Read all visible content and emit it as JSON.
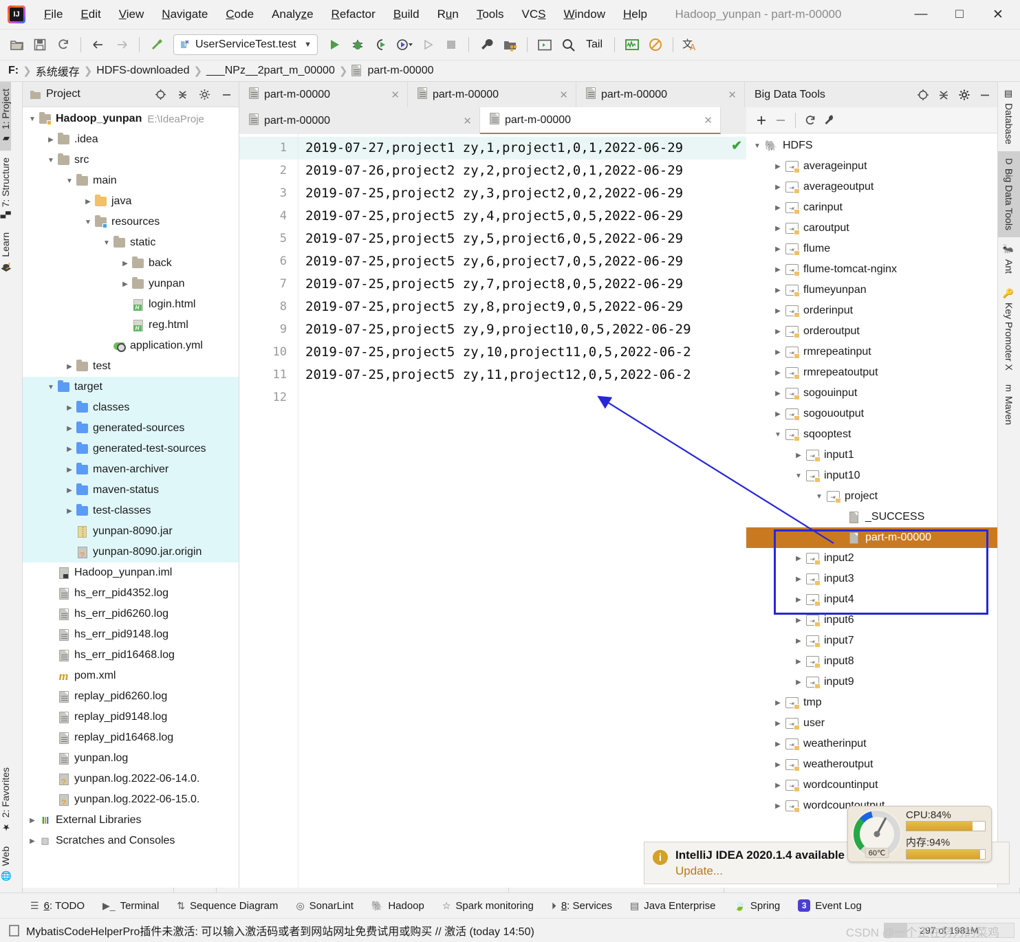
{
  "window": {
    "title": "Hadoop_yunpan - part-m-00000",
    "minimize": "—",
    "maximize": "□",
    "close": "✕"
  },
  "menubar": [
    {
      "label": "File",
      "mnemonic": "F"
    },
    {
      "label": "Edit",
      "mnemonic": "E"
    },
    {
      "label": "View",
      "mnemonic": "V"
    },
    {
      "label": "Navigate",
      "mnemonic": "N"
    },
    {
      "label": "Code",
      "mnemonic": "C"
    },
    {
      "label": "Analyze",
      "mnemonic": "z"
    },
    {
      "label": "Refactor",
      "mnemonic": "R"
    },
    {
      "label": "Build",
      "mnemonic": "B"
    },
    {
      "label": "Run",
      "mnemonic": "u"
    },
    {
      "label": "Tools",
      "mnemonic": "T"
    },
    {
      "label": "VCS",
      "mnemonic": "S"
    },
    {
      "label": "Window",
      "mnemonic": "W"
    },
    {
      "label": "Help",
      "mnemonic": "H"
    }
  ],
  "toolbar": {
    "run_config": "UserServiceTest.test",
    "tail_label": "Tail",
    "icons": [
      "open-folder-icon",
      "save-icon",
      "sync-icon",
      "back-arrow-icon",
      "forward-arrow-icon",
      "build-icon",
      "run-icon",
      "debug-icon",
      "run-coverage-icon",
      "profile-icon",
      "run-step-icon",
      "stop-icon",
      "settings-wrench-icon",
      "project-structure-icon",
      "terminal-window-icon",
      "search-icon",
      "monitor-icon",
      "block-icon",
      "translate-icon"
    ]
  },
  "breadcrumb": {
    "items": [
      "F:",
      "系统缓存",
      "HDFS-downloaded",
      "___NPz__2part_m_00000",
      "part-m-00000"
    ]
  },
  "left_strip": {
    "top": [
      {
        "label": "1: Project",
        "icon": "project-folder-icon",
        "selected": true
      },
      {
        "label": "7: Structure",
        "icon": "structure-icon",
        "selected": false
      },
      {
        "label": "Learn",
        "icon": "graduation-cap-icon",
        "selected": false
      }
    ],
    "bottom": [
      {
        "label": "2: Favorites",
        "icon": "star-icon",
        "selected": false
      },
      {
        "label": "Web",
        "icon": "globe-icon",
        "selected": false
      }
    ]
  },
  "right_strip": {
    "items": [
      {
        "label": "Database",
        "icon": "database-icon",
        "selected": false
      },
      {
        "label": "Big Data Tools",
        "icon": "bigdata-icon",
        "selected": true
      },
      {
        "label": "Ant",
        "icon": "ant-icon",
        "selected": false
      },
      {
        "label": "Key Promoter X",
        "icon": "key-promoter-icon",
        "selected": false
      },
      {
        "label": "Maven",
        "icon": "maven-icon",
        "selected": false
      }
    ]
  },
  "project_panel": {
    "title": "Project",
    "header_icons": [
      "locate-icon",
      "collapse-all-icon",
      "settings-gear-icon",
      "minimize-icon"
    ],
    "tree": [
      {
        "label": "Hadoop_yunpan",
        "suffix": "E:\\IdeaProje",
        "indent": 0,
        "arrow": "down",
        "icon": "module-folder-icon",
        "bold": true,
        "highlight": false
      },
      {
        "label": ".idea",
        "indent": 1,
        "arrow": "right",
        "icon": "folder-icon",
        "highlight": false
      },
      {
        "label": "src",
        "indent": 1,
        "arrow": "down",
        "icon": "folder-icon",
        "highlight": false
      },
      {
        "label": "main",
        "indent": 2,
        "arrow": "down",
        "icon": "folder-icon",
        "highlight": false
      },
      {
        "label": "java",
        "indent": 3,
        "arrow": "right",
        "icon": "source-folder-icon",
        "highlight": false
      },
      {
        "label": "resources",
        "indent": 3,
        "arrow": "down",
        "icon": "resource-folder-icon",
        "highlight": false
      },
      {
        "label": "static",
        "indent": 4,
        "arrow": "down",
        "icon": "folder-icon",
        "highlight": false
      },
      {
        "label": "back",
        "indent": 5,
        "arrow": "right",
        "icon": "folder-icon",
        "highlight": false
      },
      {
        "label": "yunpan",
        "indent": 5,
        "arrow": "right",
        "icon": "folder-icon",
        "highlight": false
      },
      {
        "label": "login.html",
        "indent": 5,
        "arrow": "none",
        "icon": "html-file-icon",
        "highlight": false
      },
      {
        "label": "reg.html",
        "indent": 5,
        "arrow": "none",
        "icon": "html-file-icon",
        "highlight": false
      },
      {
        "label": "application.yml",
        "indent": 4,
        "arrow": "none",
        "icon": "spring-yml-icon",
        "highlight": false
      },
      {
        "label": "test",
        "indent": 2,
        "arrow": "right",
        "icon": "folder-icon",
        "highlight": false
      },
      {
        "label": "target",
        "indent": 1,
        "arrow": "down",
        "icon": "blue-folder-icon",
        "highlight": true
      },
      {
        "label": "classes",
        "indent": 2,
        "arrow": "right",
        "icon": "blue-folder-icon",
        "highlight": true
      },
      {
        "label": "generated-sources",
        "indent": 2,
        "arrow": "right",
        "icon": "blue-folder-icon",
        "highlight": true
      },
      {
        "label": "generated-test-sources",
        "indent": 2,
        "arrow": "right",
        "icon": "blue-folder-icon",
        "highlight": true
      },
      {
        "label": "maven-archiver",
        "indent": 2,
        "arrow": "right",
        "icon": "blue-folder-icon",
        "highlight": true
      },
      {
        "label": "maven-status",
        "indent": 2,
        "arrow": "right",
        "icon": "blue-folder-icon",
        "highlight": true
      },
      {
        "label": "test-classes",
        "indent": 2,
        "arrow": "right",
        "icon": "blue-folder-icon",
        "highlight": true
      },
      {
        "label": "yunpan-8090.jar",
        "indent": 2,
        "arrow": "none",
        "icon": "jar-file-icon",
        "highlight": true
      },
      {
        "label": "yunpan-8090.jar.origin",
        "indent": 2,
        "arrow": "none",
        "icon": "unknown-file-icon",
        "highlight": true
      },
      {
        "label": "Hadoop_yunpan.iml",
        "indent": 1,
        "arrow": "none",
        "icon": "iml-file-icon",
        "highlight": false
      },
      {
        "label": "hs_err_pid4352.log",
        "indent": 1,
        "arrow": "none",
        "icon": "text-file-icon",
        "highlight": false
      },
      {
        "label": "hs_err_pid6260.log",
        "indent": 1,
        "arrow": "none",
        "icon": "text-file-icon",
        "highlight": false
      },
      {
        "label": "hs_err_pid9148.log",
        "indent": 1,
        "arrow": "none",
        "icon": "text-file-icon",
        "highlight": false
      },
      {
        "label": "hs_err_pid16468.log",
        "indent": 1,
        "arrow": "none",
        "icon": "text-file-icon",
        "highlight": false
      },
      {
        "label": "pom.xml",
        "indent": 1,
        "arrow": "none",
        "icon": "maven-pom-icon",
        "highlight": false
      },
      {
        "label": "replay_pid6260.log",
        "indent": 1,
        "arrow": "none",
        "icon": "text-file-icon",
        "highlight": false
      },
      {
        "label": "replay_pid9148.log",
        "indent": 1,
        "arrow": "none",
        "icon": "text-file-icon",
        "highlight": false
      },
      {
        "label": "replay_pid16468.log",
        "indent": 1,
        "arrow": "none",
        "icon": "text-file-icon",
        "highlight": false
      },
      {
        "label": "yunpan.log",
        "indent": 1,
        "arrow": "none",
        "icon": "text-file-icon",
        "highlight": false
      },
      {
        "label": "yunpan.log.2022-06-14.0.",
        "indent": 1,
        "arrow": "none",
        "icon": "unknown-file-icon",
        "highlight": false
      },
      {
        "label": "yunpan.log.2022-06-15.0.",
        "indent": 1,
        "arrow": "none",
        "icon": "unknown-file-icon",
        "highlight": false
      },
      {
        "label": "External Libraries",
        "indent": 0,
        "arrow": "right",
        "icon": "libraries-icon",
        "highlight": false
      },
      {
        "label": "Scratches and Consoles",
        "indent": 0,
        "arrow": "right",
        "icon": "scratches-icon",
        "highlight": false
      }
    ]
  },
  "editor": {
    "tabs_row1": [
      {
        "label": "part-m-00000",
        "active": false
      },
      {
        "label": "part-m-00000",
        "active": false
      },
      {
        "label": "part-m-00000",
        "active": false
      }
    ],
    "tabs_row2": [
      {
        "label": "part-m-00000",
        "active": false
      },
      {
        "label": "part-m-00000",
        "active": true
      }
    ],
    "line_numbers": [
      "1",
      "2",
      "3",
      "4",
      "5",
      "6",
      "7",
      "8",
      "9",
      "10",
      "11",
      "12"
    ],
    "lines": [
      "2019-07-27,project1 zy,1,project1,0,1,2022-06-29",
      "2019-07-26,project2 zy,2,project2,0,1,2022-06-29",
      "2019-07-25,project2 zy,3,project2,0,2,2022-06-29",
      "2019-07-25,project5 zy,4,project5,0,5,2022-06-29",
      "2019-07-25,project5 zy,5,project6,0,5,2022-06-29",
      "2019-07-25,project5 zy,6,project7,0,5,2022-06-29",
      "2019-07-25,project5 zy,7,project8,0,5,2022-06-29",
      "2019-07-25,project5 zy,8,project9,0,5,2022-06-29",
      "2019-07-25,project5 zy,9,project10,0,5,2022-06-29",
      "2019-07-25,project5 zy,10,project11,0,5,2022-06-2",
      "2019-07-25,project5 zy,11,project12,0,5,2022-06-2",
      ""
    ],
    "inspection_ok": "✔"
  },
  "bigdata": {
    "title": "Big Data Tools",
    "header_icons": [
      "locate-icon",
      "collapse-all-icon",
      "settings-gear-icon",
      "minimize-icon"
    ],
    "toolbar_icons": [
      "add-icon",
      "remove-icon",
      "refresh-icon",
      "wrench-icon"
    ],
    "tree": [
      {
        "label": "HDFS",
        "indent": 0,
        "arrow": "down",
        "icon": "hadoop-elephant-icon",
        "state": "normal"
      },
      {
        "label": "averageinput",
        "indent": 1,
        "arrow": "right",
        "icon": "hdfs-folder-icon",
        "state": "normal"
      },
      {
        "label": "averageoutput",
        "indent": 1,
        "arrow": "right",
        "icon": "hdfs-folder-icon",
        "state": "normal"
      },
      {
        "label": "carinput",
        "indent": 1,
        "arrow": "right",
        "icon": "hdfs-folder-icon",
        "state": "normal"
      },
      {
        "label": "caroutput",
        "indent": 1,
        "arrow": "right",
        "icon": "hdfs-folder-icon",
        "state": "normal"
      },
      {
        "label": "flume",
        "indent": 1,
        "arrow": "right",
        "icon": "hdfs-folder-icon",
        "state": "normal"
      },
      {
        "label": "flume-tomcat-nginx",
        "indent": 1,
        "arrow": "right",
        "icon": "hdfs-folder-icon",
        "state": "normal"
      },
      {
        "label": "flumeyunpan",
        "indent": 1,
        "arrow": "right",
        "icon": "hdfs-folder-icon",
        "state": "normal"
      },
      {
        "label": "orderinput",
        "indent": 1,
        "arrow": "right",
        "icon": "hdfs-folder-icon",
        "state": "normal"
      },
      {
        "label": "orderoutput",
        "indent": 1,
        "arrow": "right",
        "icon": "hdfs-folder-icon",
        "state": "normal"
      },
      {
        "label": "rmrepeatinput",
        "indent": 1,
        "arrow": "right",
        "icon": "hdfs-folder-icon",
        "state": "normal"
      },
      {
        "label": "rmrepeatoutput",
        "indent": 1,
        "arrow": "right",
        "icon": "hdfs-folder-icon",
        "state": "normal"
      },
      {
        "label": "sogouinput",
        "indent": 1,
        "arrow": "right",
        "icon": "hdfs-folder-icon",
        "state": "normal"
      },
      {
        "label": "sogououtput",
        "indent": 1,
        "arrow": "right",
        "icon": "hdfs-folder-icon",
        "state": "normal"
      },
      {
        "label": "sqooptest",
        "indent": 1,
        "arrow": "down",
        "icon": "hdfs-folder-icon",
        "state": "normal"
      },
      {
        "label": "input1",
        "indent": 2,
        "arrow": "right",
        "icon": "hdfs-folder-icon",
        "state": "normal"
      },
      {
        "label": "input10",
        "indent": 2,
        "arrow": "down",
        "icon": "hdfs-folder-icon",
        "state": "normal"
      },
      {
        "label": "project",
        "indent": 3,
        "arrow": "down",
        "icon": "hdfs-folder-icon",
        "state": "normal"
      },
      {
        "label": "_SUCCESS",
        "indent": 4,
        "arrow": "none",
        "icon": "hdfs-file-icon",
        "state": "normal"
      },
      {
        "label": "part-m-00000",
        "indent": 4,
        "arrow": "none",
        "icon": "hdfs-file-icon",
        "state": "selected"
      },
      {
        "label": "input2",
        "indent": 2,
        "arrow": "right",
        "icon": "hdfs-folder-icon",
        "state": "normal"
      },
      {
        "label": "input3",
        "indent": 2,
        "arrow": "right",
        "icon": "hdfs-folder-icon",
        "state": "normal"
      },
      {
        "label": "input4",
        "indent": 2,
        "arrow": "right",
        "icon": "hdfs-folder-icon",
        "state": "normal"
      },
      {
        "label": "input6",
        "indent": 2,
        "arrow": "right",
        "icon": "hdfs-folder-icon",
        "state": "normal"
      },
      {
        "label": "input7",
        "indent": 2,
        "arrow": "right",
        "icon": "hdfs-folder-icon",
        "state": "normal"
      },
      {
        "label": "input8",
        "indent": 2,
        "arrow": "right",
        "icon": "hdfs-folder-icon",
        "state": "normal"
      },
      {
        "label": "input9",
        "indent": 2,
        "arrow": "right",
        "icon": "hdfs-folder-icon",
        "state": "normal"
      },
      {
        "label": "tmp",
        "indent": 1,
        "arrow": "right",
        "icon": "hdfs-folder-icon",
        "state": "normal"
      },
      {
        "label": "user",
        "indent": 1,
        "arrow": "right",
        "icon": "hdfs-folder-icon",
        "state": "normal"
      },
      {
        "label": "weatherinput",
        "indent": 1,
        "arrow": "right",
        "icon": "hdfs-folder-icon",
        "state": "normal"
      },
      {
        "label": "weatheroutput",
        "indent": 1,
        "arrow": "right",
        "icon": "hdfs-folder-icon",
        "state": "normal"
      },
      {
        "label": "wordcountinput",
        "indent": 1,
        "arrow": "right",
        "icon": "hdfs-folder-icon",
        "state": "normal"
      },
      {
        "label": "wordcountoutput",
        "indent": 1,
        "arrow": "right",
        "icon": "hdfs-folder-icon",
        "state": "normal"
      }
    ]
  },
  "notification": {
    "title": "IntelliJ IDEA 2020.1.4 available",
    "link": "Update...",
    "icon": "info-icon"
  },
  "cpu_widget": {
    "cpu_label": "CPU:84%",
    "cpu_percent": 84,
    "mem_label": "内存:94%",
    "mem_percent": 94,
    "temp_label": "60℃"
  },
  "statusbar": {
    "items": [
      {
        "label": "6: TODO",
        "mnemonic": "6",
        "icon": "todo-list-icon"
      },
      {
        "label": "Terminal",
        "icon": "terminal-icon"
      },
      {
        "label": "Sequence Diagram",
        "icon": "sequence-diagram-icon"
      },
      {
        "label": "SonarLint",
        "icon": "sonarlint-icon"
      },
      {
        "label": "Hadoop",
        "icon": "hadoop-elephant-icon"
      },
      {
        "label": "Spark monitoring",
        "icon": "star-outline-icon"
      },
      {
        "label": "8: Services",
        "mnemonic": "8",
        "icon": "services-play-icon"
      },
      {
        "label": "Java Enterprise",
        "icon": "java-enterprise-icon"
      },
      {
        "label": "Spring",
        "icon": "spring-leaf-icon"
      },
      {
        "label": "Event Log",
        "icon": "event-log-icon",
        "badge": "3"
      }
    ]
  },
  "message_bar": {
    "icon": "plugin-icon",
    "text": "MybatisCodeHelperPro插件未激活: 可以输入激活码或者到网站网址免费试用或购买 // 激活 (today 14:50)",
    "memory": "297 of 1981M",
    "watermark": "CSDN @一个正在努力的菜鸡"
  }
}
